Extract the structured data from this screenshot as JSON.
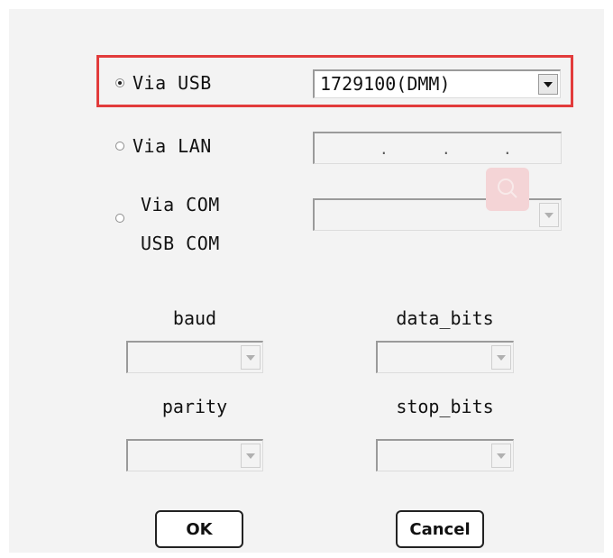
{
  "connection": {
    "usb": {
      "label": "Via USB",
      "selected": true,
      "device_value": "1729100(DMM)"
    },
    "lan": {
      "label": "Via LAN",
      "selected": false,
      "ip_placeholder": ".  .  ."
    },
    "com": {
      "label_line1": "Via COM",
      "label_line2": "USB COM",
      "selected": false,
      "value": ""
    }
  },
  "serial": {
    "baud_label": "baud",
    "data_bits_label": "data_bits",
    "parity_label": "parity",
    "stop_bits_label": "stop_bits"
  },
  "buttons": {
    "ok": "OK",
    "cancel": "Cancel"
  },
  "colors": {
    "highlight": "#e23b3b",
    "panel": "#f3f3f3",
    "search_badge": "#f4d4d6"
  },
  "icons": {
    "search_badge": "search-icon"
  }
}
